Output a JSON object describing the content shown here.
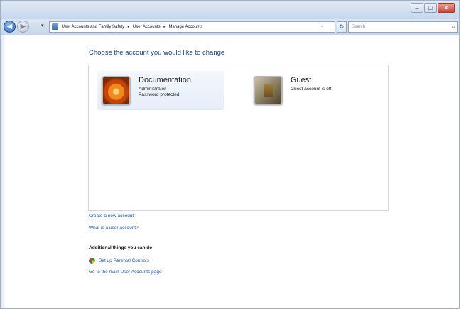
{
  "window": {
    "caption_minimize": "–",
    "caption_maximize": "□",
    "caption_close": "✕"
  },
  "nav": {
    "back_glyph": "◀",
    "forward_glyph": "▶",
    "recent_glyph": "▾",
    "breadcrumbs": [
      "User Accounts and Family Safety",
      "User Accounts",
      "Manage Accounts"
    ],
    "crumb_separator": "▸",
    "address_drop_glyph": "▾",
    "refresh_glyph": "↻",
    "search_placeholder": "Search",
    "search_glyph": "⌕"
  },
  "main": {
    "heading": "Choose the account you would like to change",
    "accounts": [
      {
        "name": "Documentation",
        "lines": [
          "Administrator",
          "Password protected"
        ],
        "selected": true,
        "picture": "flower"
      },
      {
        "name": "Guest",
        "lines": [
          "Guest account is off"
        ],
        "selected": false,
        "picture": "guest"
      }
    ],
    "links": {
      "create_account": "Create a new account",
      "what_is_account": "What is a user account?"
    },
    "additional": {
      "title": "Additional things you can do",
      "parental_controls": "Set up Parental Controls",
      "main_page": "Go to the main User Accounts page"
    }
  },
  "colors": {
    "heading": "#1e3f84",
    "link": "#1a56b0",
    "selected_tile": "#e6eef9"
  },
  "icons": {
    "address": "user-accounts-icon",
    "parental": "parental-controls-shield-icon"
  }
}
